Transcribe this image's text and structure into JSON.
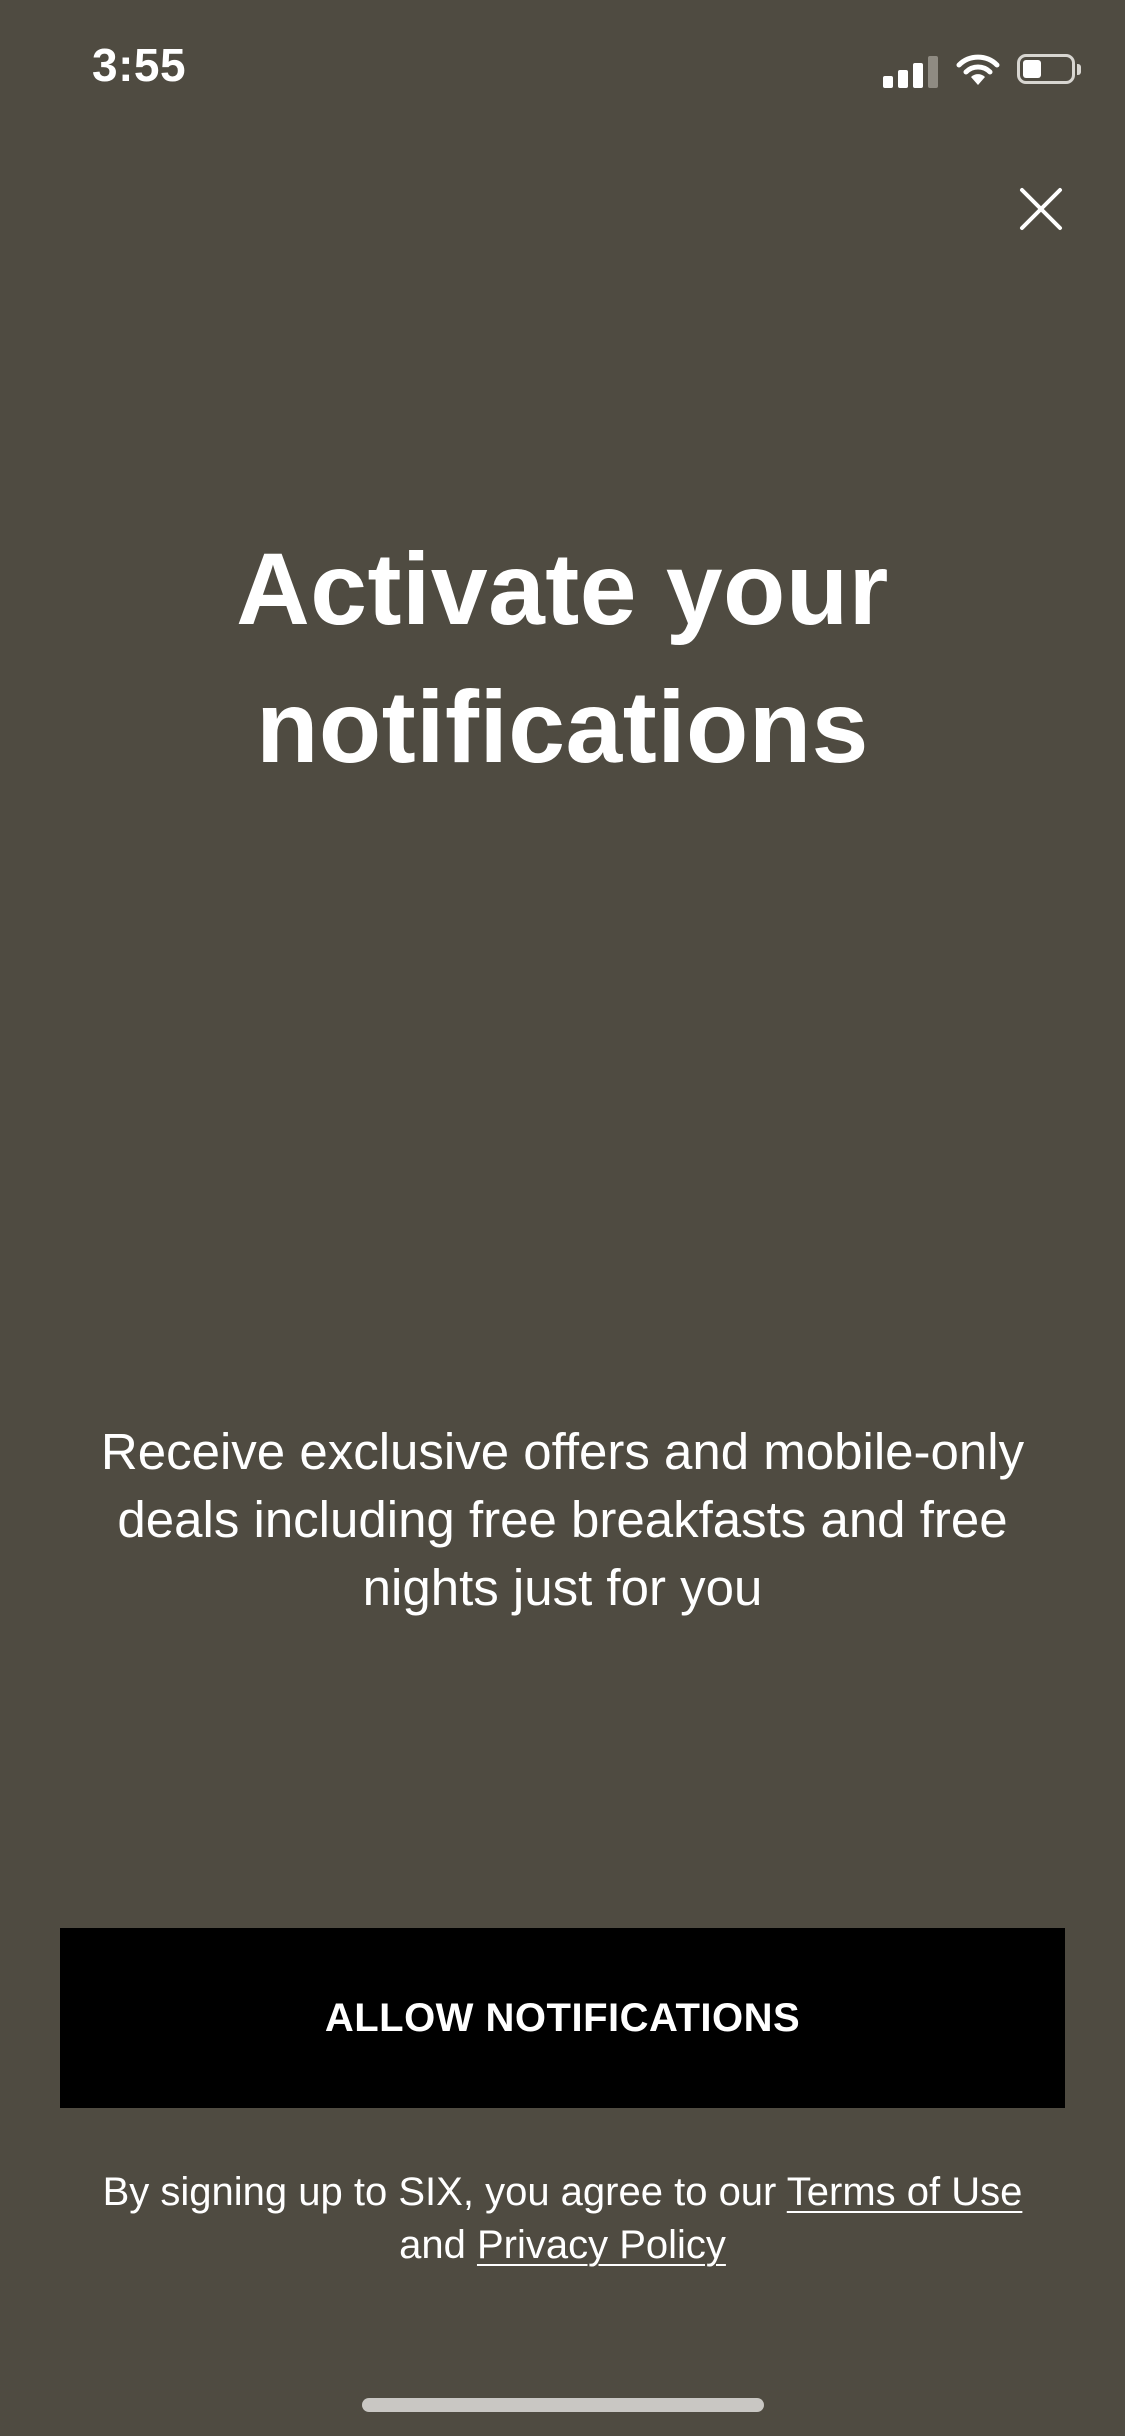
{
  "status_bar": {
    "time": "3:55",
    "signal_icon": "cellular-signal-icon",
    "wifi_icon": "wifi-icon",
    "battery_icon": "battery-icon",
    "battery_level": 0.4
  },
  "close_icon": "close-icon",
  "title": {
    "line1": "Activate your",
    "line2": "notifications"
  },
  "description": {
    "line1": "Receive exclusive offers and mobile-only",
    "line2": "deals including free breakfasts and free",
    "line3": "nights just for you"
  },
  "cta": {
    "label": "ALLOW NOTIFICATIONS"
  },
  "legal": {
    "prefix": "By signing up to SIX, you agree to our ",
    "terms_link": "Terms of Use",
    "conjunction": " and ",
    "privacy_link": "Privacy Policy"
  },
  "colors": {
    "background": "#4f4b41",
    "button": "#000000",
    "text": "#ffffff"
  }
}
